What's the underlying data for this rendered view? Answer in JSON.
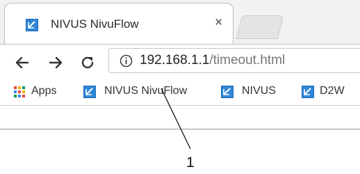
{
  "tab": {
    "title": "NIVUS NivuFlow",
    "close_glyph": "×",
    "favicon": "nivus-favicon"
  },
  "toolbar": {
    "back_icon": "back-arrow-icon",
    "forward_icon": "forward-arrow-icon",
    "reload_icon": "reload-icon",
    "info_icon": "info-icon",
    "url_host": "192.168.1.1",
    "url_path": "/timeout.html"
  },
  "bookmarks": {
    "apps_label": "Apps",
    "items": [
      {
        "label": "NIVUS NivuFlow",
        "icon": "nivus-favicon"
      },
      {
        "label": "NIVUS",
        "icon": "nivus-favicon"
      },
      {
        "label": "D2W",
        "icon": "nivus-favicon"
      }
    ]
  },
  "callout": {
    "number": "1"
  },
  "colors": {
    "favicon_blue": "#2f86d8",
    "frame_border": "#9a9a9a"
  }
}
